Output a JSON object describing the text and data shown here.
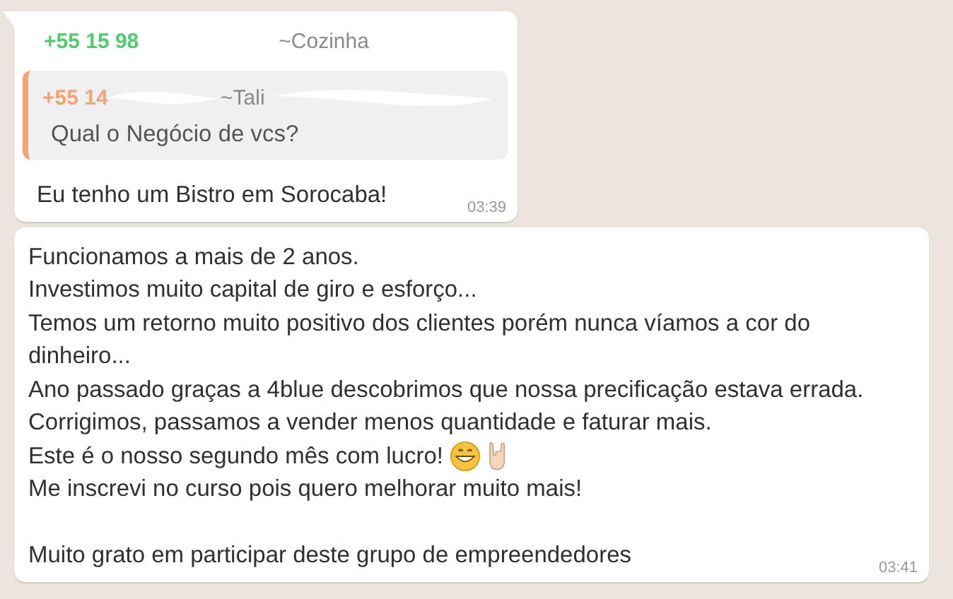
{
  "messages": [
    {
      "kind": "reply",
      "sender": "+55 15 98",
      "sender_name": "~Cozinha",
      "quote": {
        "sender": "+55 14",
        "sender_name": "~Tali",
        "text": "Qual o Negócio de vcs?"
      },
      "lines": [
        {
          "kind": "text",
          "text": "Eu tenho um Bistro em Sorocaba!"
        }
      ],
      "time": "03:39"
    },
    {
      "kind": "plain",
      "lines": [
        {
          "kind": "text",
          "text": "Funcionamos a mais de 2 anos."
        },
        {
          "kind": "text",
          "text": "Investimos muito capital de giro e esforço..."
        },
        {
          "kind": "text",
          "text": "Temos um retorno muito positivo dos clientes porém nunca víamos a cor do dinheiro..."
        },
        {
          "kind": "text",
          "text": "Ano passado graças a 4blue descobrimos que nossa precificação estava errada."
        },
        {
          "kind": "text",
          "text": "Corrigimos, passamos a vender menos quantidade e faturar mais."
        },
        {
          "kind": "emoji",
          "text": "Este é o nosso segundo mês com lucro!"
        },
        {
          "kind": "text",
          "text": "Me inscrevi no curso pois quero melhorar muito mais!"
        },
        {
          "kind": "blank"
        },
        {
          "kind": "text",
          "text": "Muito grato em participar deste grupo de empreendedores"
        }
      ],
      "time": "03:41"
    }
  ]
}
